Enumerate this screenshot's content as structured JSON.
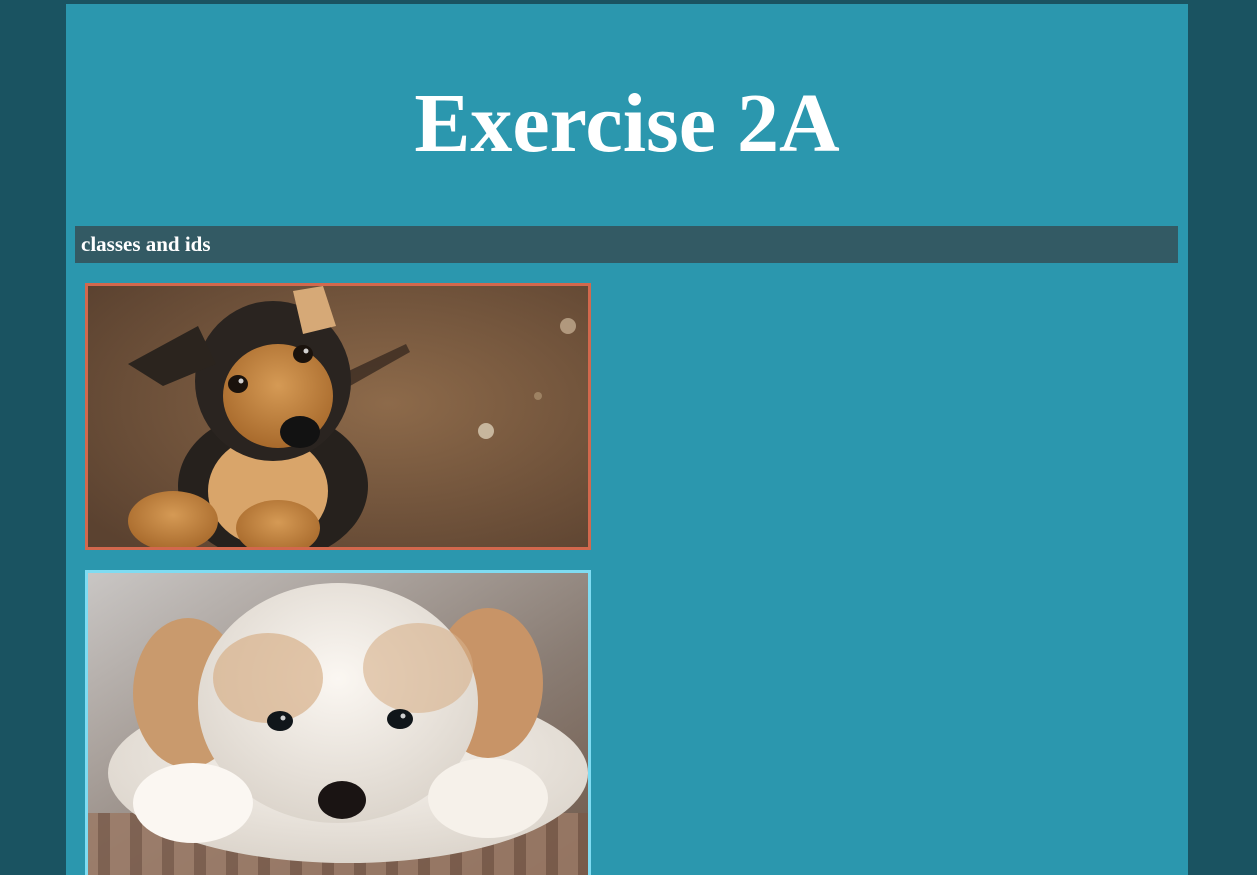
{
  "page": {
    "title": "Exercise 2A"
  },
  "section": {
    "heading": "classes and ids"
  },
  "images": [
    {
      "description": "puppy-brown-tan",
      "border_color": "#d2684d"
    },
    {
      "description": "puppy-white-fluffy",
      "border_color": "#7fdcf2"
    }
  ],
  "colors": {
    "outer_background": "#1a5361",
    "page_background": "#2b97ae",
    "section_bar": "#335a64",
    "text": "#ffffff"
  }
}
